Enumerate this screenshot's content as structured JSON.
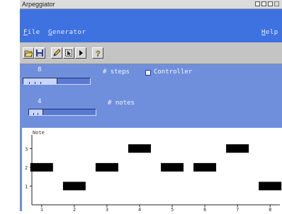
{
  "window": {
    "title": "Arpeggiator"
  },
  "menu": {
    "file": {
      "hotkey": "F",
      "rest": "ile"
    },
    "generator": {
      "hotkey": "G",
      "rest": "enerator"
    },
    "help": {
      "hotkey": "H",
      "rest": "elp"
    }
  },
  "toolbar": {
    "icons": [
      "open-folder-icon",
      "save-icon",
      "pencil-icon",
      "select-icon",
      "play-icon",
      "help-icon"
    ]
  },
  "steps": {
    "value": "8",
    "label": "# steps",
    "level": 0.5
  },
  "notes": {
    "value": "4",
    "label": "# notes",
    "level": 0.2
  },
  "controller": {
    "label": "Controller",
    "checked": false
  },
  "chart_data": {
    "type": "scatter",
    "title": "Note",
    "xlabel": "",
    "ylabel": "",
    "x": [
      1,
      2,
      3,
      4,
      5,
      6,
      7,
      8
    ],
    "y": [
      2,
      1,
      2,
      3,
      2,
      2,
      3,
      1
    ],
    "xticks": [
      "1",
      "2",
      "3",
      "4",
      "5",
      "6",
      "7",
      "8"
    ],
    "yticks": [
      "1",
      "2",
      "3"
    ],
    "xlim": [
      0.7,
      8.3
    ],
    "ylim": [
      0,
      3.5
    ],
    "grid": false,
    "mark_color": "#000000"
  }
}
